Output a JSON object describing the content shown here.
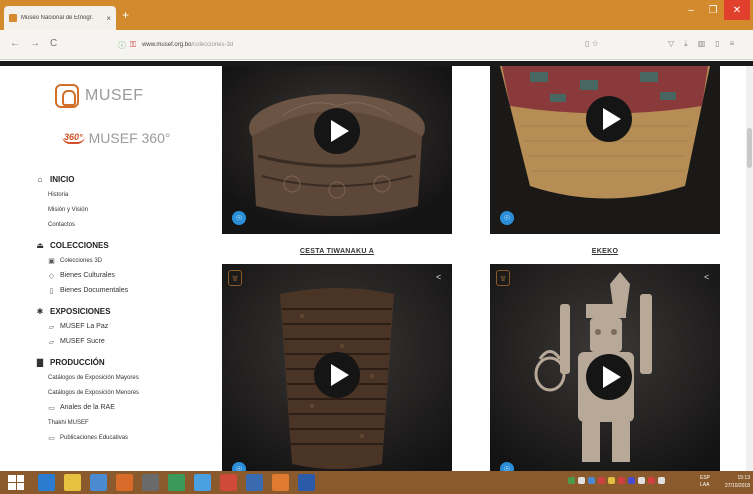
{
  "browser": {
    "tab_title": "Museo Nacional de Etnogr.",
    "tab_close": "×",
    "new_tab": "+",
    "window_controls": {
      "minimize": "–",
      "maximize": "❐",
      "close": "✕"
    },
    "nav": {
      "back": "←",
      "forward": "→",
      "reload": "C"
    },
    "url_host": "www.musef.org.bo",
    "url_path": "/colecciones-3d",
    "url_right_icons": "▯ ☆",
    "toolbar_icons": [
      "▽",
      "⤓",
      "▥",
      "▯",
      "≡"
    ]
  },
  "sidebar": {
    "logo_text": "MUSEF",
    "logo360_mark": "360°",
    "logo360_text": "MUSEF 360°",
    "sections": [
      {
        "icon": "home-icon",
        "glyph": "⌂",
        "label": "INICIO",
        "items": [
          {
            "label": "Historia"
          },
          {
            "label": "Misión y Visión"
          },
          {
            "label": "Contactos"
          }
        ]
      },
      {
        "icon": "bank-icon",
        "glyph": "⏏",
        "label": "COLECCIONES",
        "items": [
          {
            "label": "Colecciones 3D",
            "glyph": "▣"
          },
          {
            "label": "Bienes Culturales",
            "glyph": "◇"
          },
          {
            "label": "Bienes Documentales",
            "glyph": "▯"
          }
        ]
      },
      {
        "icon": "gear-icon",
        "glyph": "✱",
        "label": "EXPOSICIONES",
        "items": [
          {
            "label": "MUSEF La Paz",
            "glyph": "▱"
          },
          {
            "label": "MUSEF Sucre",
            "glyph": "▱"
          }
        ]
      },
      {
        "icon": "book-icon",
        "glyph": "▇",
        "label": "PRODUCCIÓN",
        "items": [
          {
            "label": "Catálogos de Exposición Mayores"
          },
          {
            "label": "Catálogos de Exposición Menores"
          },
          {
            "label": "Anales de la RAE",
            "glyph": "▭"
          },
          {
            "label": "Thakhi MUSEF"
          },
          {
            "label": "Publicaciones Educativas",
            "glyph": "▭"
          }
        ]
      }
    ]
  },
  "gallery": {
    "cards": [
      {
        "caption": "",
        "badge": "☉"
      },
      {
        "caption": "",
        "badge": "☉"
      },
      {
        "caption": "",
        "badge": "☉",
        "share": "<",
        "corner": "۩"
      },
      {
        "caption": "",
        "badge": "☉",
        "share": "<",
        "corner": "۩"
      }
    ],
    "captions_row": [
      "CESTA TIWANAKU A",
      "EKEKO"
    ]
  },
  "taskbar": {
    "lang": "ESP",
    "lang_sub": "LAA",
    "time": "15:13",
    "date": "27/10/2018"
  },
  "colors": {
    "titlebar": "#d28a2c",
    "taskbar": "#8a5a2c",
    "brand": "#d0702a",
    "badge": "#2a8fd8"
  }
}
